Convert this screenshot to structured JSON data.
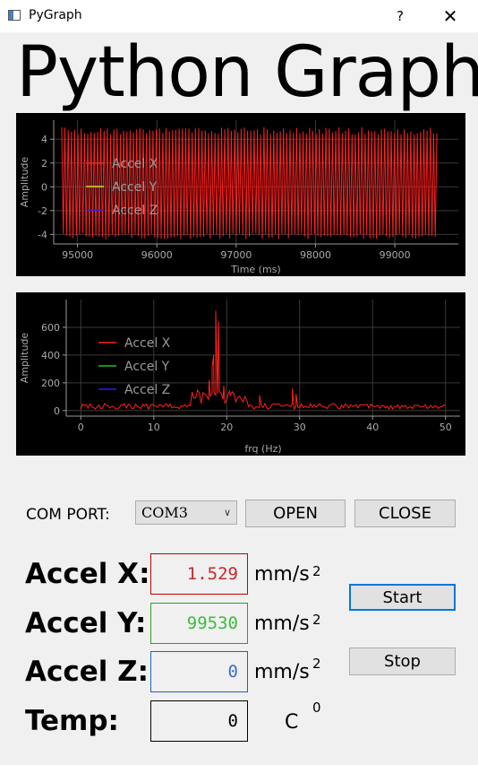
{
  "window": {
    "title": "PyGraph",
    "help": "?",
    "close": "✕"
  },
  "heading": "Python Graph",
  "controls": {
    "com_port_label": "COM PORT:",
    "com_port_value": "COM3",
    "open_label": "OPEN",
    "close_label": "CLOSE",
    "start_label": "Start",
    "stop_label": "Stop"
  },
  "readouts": [
    {
      "label": "Accel X:",
      "value": "1.529",
      "unit": "mm/s",
      "sup": "2"
    },
    {
      "label": "Accel Y:",
      "value": "99530",
      "unit": "mm/s",
      "sup": "2"
    },
    {
      "label": "Accel Z:",
      "value": "0",
      "unit": "mm/s",
      "sup": "2"
    },
    {
      "label": "Temp:",
      "value": "0",
      "unit": "C",
      "sup": "0"
    }
  ],
  "colors": {
    "x": "#ff2020",
    "y": "#20c020",
    "z": "#2020ff"
  },
  "chart_data": [
    {
      "type": "line",
      "xlabel": "Time (ms)",
      "ylabel": "Amplitude",
      "xlim": [
        94700,
        99800
      ],
      "ylim": [
        -4.8,
        5.6
      ],
      "xticks": [
        95000,
        96000,
        97000,
        98000,
        99000
      ],
      "yticks": [
        -4,
        -2,
        0,
        2,
        4
      ],
      "series": [
        {
          "name": "Accel X",
          "color": "#ff2020",
          "pattern": "oscillation",
          "x_range": [
            94800,
            99530
          ],
          "amplitude_range": [
            -4.4,
            5.0
          ]
        },
        {
          "name": "Accel Y",
          "color": "#c8e020",
          "values": []
        },
        {
          "name": "Accel Z",
          "color": "#2020ff",
          "values": []
        }
      ],
      "legend": "top-left",
      "grid": true
    },
    {
      "type": "line",
      "xlabel": "frq (Hz)",
      "ylabel": "Amplitude",
      "xlim": [
        -2,
        52
      ],
      "ylim": [
        -40,
        800
      ],
      "xticks": [
        0,
        10,
        20,
        30,
        40,
        50
      ],
      "yticks": [
        0,
        200,
        400,
        600
      ],
      "series": [
        {
          "name": "Accel X",
          "color": "#ff2020",
          "peaks": [
            [
              18.5,
              720
            ],
            [
              18.9,
              640
            ],
            [
              18.2,
              400
            ],
            [
              18.0,
              310
            ],
            [
              17.6,
              220
            ],
            [
              19.6,
              180
            ],
            [
              20.4,
              140
            ],
            [
              24.5,
              110
            ],
            [
              29.0,
              160
            ],
            [
              29.5,
              120
            ]
          ]
        },
        {
          "name": "Accel Y",
          "color": "#20c020",
          "values": []
        },
        {
          "name": "Accel Z",
          "color": "#2020ff",
          "values": []
        }
      ],
      "legend": "top-left",
      "grid": true
    }
  ]
}
